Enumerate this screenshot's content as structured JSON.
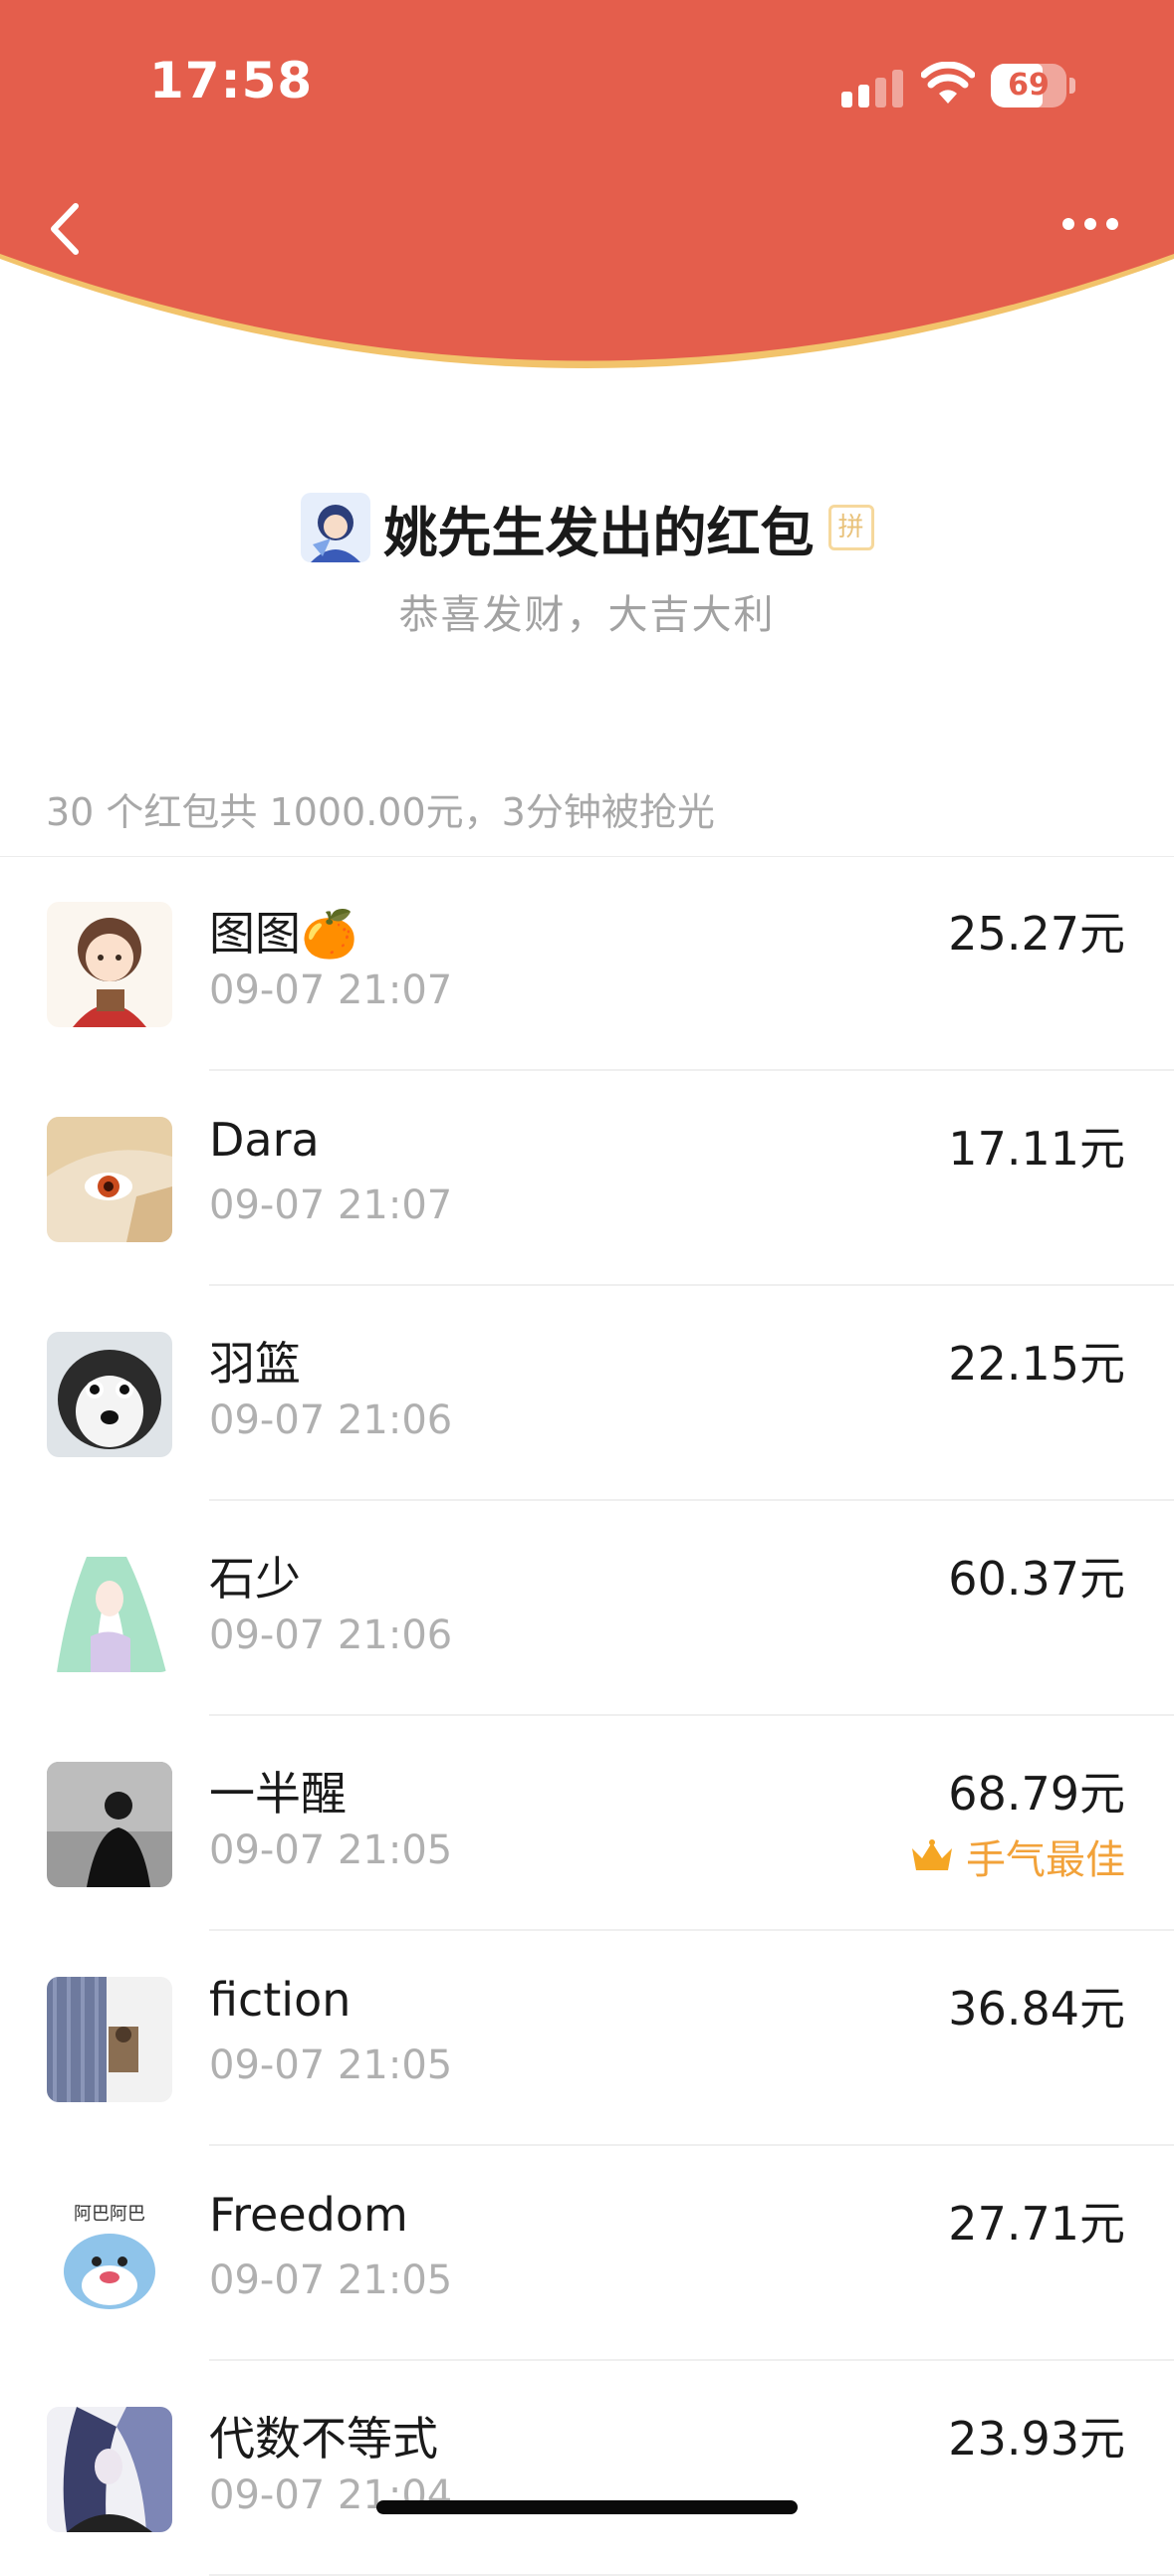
{
  "status_bar": {
    "time": "17:58",
    "battery": "69",
    "battery_level": 0.69
  },
  "header": {
    "back_icon": "chevron-left-icon",
    "more_icon": "ellipsis-icon",
    "accent_color": "#e45e4c"
  },
  "packet": {
    "title": "姚先生发出的红包",
    "pin_badge": "拼",
    "blessing": "恭喜发财，大吉大利",
    "summary": "30 个红包共 1000.00元，3分钟被抢光"
  },
  "recipients": [
    {
      "name": "图图🍊",
      "time": "09-07 21:07",
      "amount": "25.27元"
    },
    {
      "name": "Dara",
      "time": "09-07 21:07",
      "amount": "17.11元"
    },
    {
      "name": "羽篮",
      "time": "09-07 21:06",
      "amount": "22.15元"
    },
    {
      "name": "石少",
      "time": "09-07 21:06",
      "amount": "60.37元"
    },
    {
      "name": "一半醒",
      "time": "09-07 21:05",
      "amount": "68.79元",
      "best": "手气最佳"
    },
    {
      "name": "fiction",
      "time": "09-07 21:05",
      "amount": "36.84元"
    },
    {
      "name": "Freedom",
      "time": "09-07 21:05",
      "amount": "27.71元"
    },
    {
      "name": "代数不等式",
      "time": "09-07 21:04",
      "amount": "23.93元"
    }
  ]
}
